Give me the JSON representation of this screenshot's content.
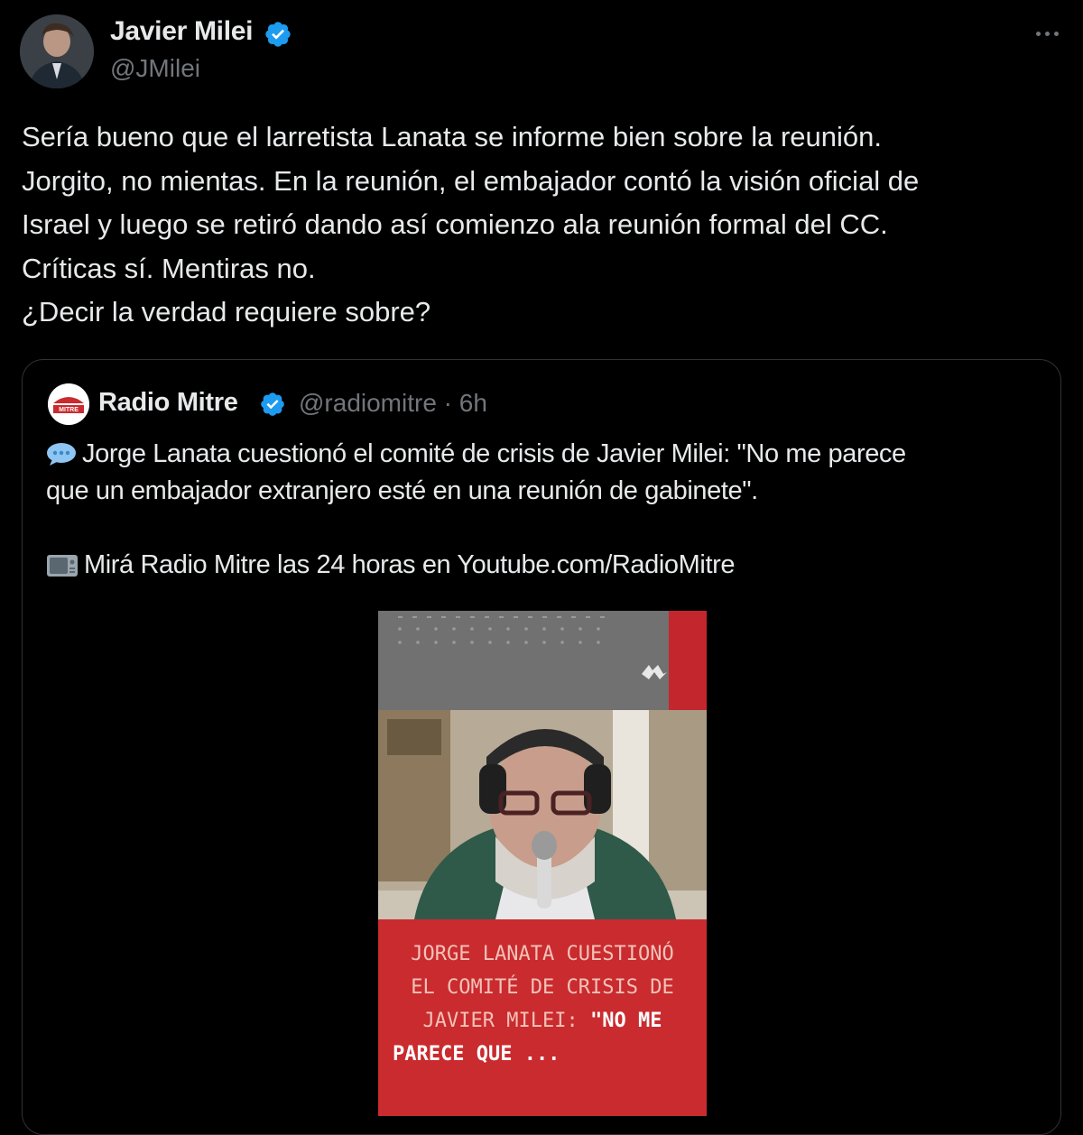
{
  "tweet": {
    "author_name": "Javier Milei",
    "author_handle": "@JMilei",
    "text_lines": [
      "Sería bueno que el larretista Lanata se informe bien sobre la reunión.",
      "Jorgito, no mientas. En la reunión, el embajador contó la visión oficial de",
      "Israel y luego se retiró dando así comienzo ala reunión formal del CC.",
      "Críticas sí. Mentiras no.",
      "¿Decir la verdad requiere sobre?"
    ]
  },
  "quote": {
    "author_name": "Radio Mitre",
    "author_handle": "@radiomitre · 6h",
    "text_lines": [
      "Jorge Lanata cuestionó el comité de crisis de Javier Milei: \"No me parece",
      "que un embajador extranjero esté en una reunión de gabinete\".",
      "",
      "Mirá Radio Mitre las 24 horas en Youtube.com/RadioMitre"
    ],
    "media_caption": {
      "line1": "JORGE LANATA CUESTIONÓ",
      "line2": "EL COMITÉ DE CRISIS DE",
      "line3_a": "JAVIER MILEI: ",
      "line3_b": "\"NO ME",
      "line4": "PARECE QUE ..."
    }
  },
  "colors": {
    "verified": "#1d9bf0",
    "text": "#e7e9ea",
    "muted": "#71767b",
    "background": "#000000",
    "media_red": "#c92b2f"
  },
  "icons": [
    "verified-badge-icon",
    "more-options-icon",
    "speech-bubble-icon",
    "tv-icon"
  ]
}
